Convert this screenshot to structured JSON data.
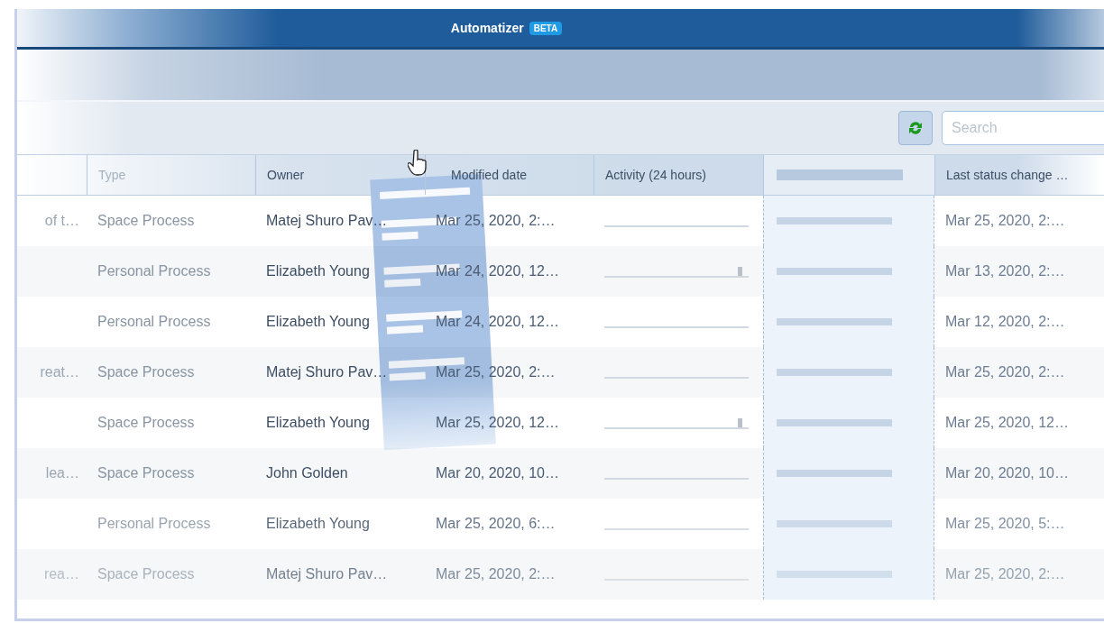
{
  "app_bar": {
    "title": "Automatizer",
    "badge": "BETA"
  },
  "toolbar": {
    "search": {
      "placeholder": "Search"
    }
  },
  "table": {
    "columns": [
      "Type",
      "Owner",
      "Modified date",
      "Activity (24 hours)",
      "Last status change …"
    ],
    "rows": [
      {
        "column_1": "of t…",
        "type": "Space Process",
        "owner": "Matej Shuro Pav…",
        "modified": "Mar 25, 2020, 2:…",
        "activity_peak": false,
        "last_status_change": "Mar 25, 2020, 2:…"
      },
      {
        "type": "Personal Process",
        "owner": "Elizabeth Young",
        "modified": "Mar 24, 2020, 12…",
        "activity_peak": true,
        "last_status_change": "Mar 13, 2020, 2:…"
      },
      {
        "type": "Personal Process",
        "owner": "Elizabeth Young",
        "modified": "Mar 24, 2020, 12…",
        "activity_peak": false,
        "last_status_change": "Mar 12, 2020, 2:…"
      },
      {
        "column_1": "reat…",
        "type": "Space Process",
        "owner": "Matej Shuro Pav…",
        "modified": "Mar 25, 2020, 2:…",
        "activity_peak": false,
        "last_status_change": "Mar 25, 2020, 2:…"
      },
      {
        "type": "Space Process",
        "owner": "Elizabeth Young",
        "modified": "Mar 25, 2020, 12…",
        "activity_peak": true,
        "last_status_change": "Mar 25, 2020, 12…"
      },
      {
        "column_1": "lea…",
        "type": "Space Process",
        "owner": "John Golden",
        "modified": "Mar 20, 2020, 10…",
        "activity_peak": false,
        "last_status_change": "Mar 20, 2020, 10…"
      },
      {
        "type": "Personal Process",
        "owner": "Elizabeth Young",
        "modified": "Mar 25, 2020, 6:…",
        "activity_peak": false,
        "last_status_change": "Mar 25, 2020, 5:…"
      },
      {
        "column_1": "rea…",
        "type": "Space Process",
        "owner": "Matej Shuro Pav…",
        "modified": "Mar 25, 2020, 2:…",
        "activity_peak": false,
        "last_status_change": "Mar 25, 2020, 2:…"
      }
    ]
  }
}
